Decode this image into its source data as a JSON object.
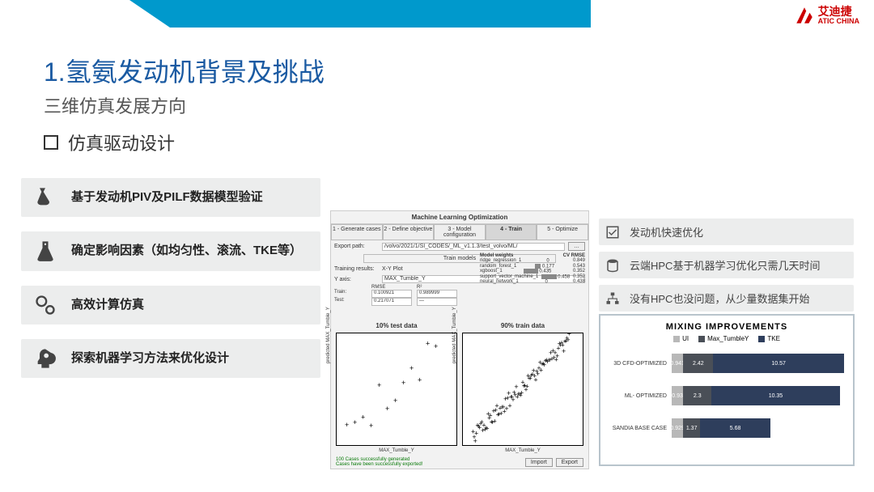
{
  "logo": {
    "cn": "艾迪捷",
    "en": "ATIC CHINA"
  },
  "main_title": "1.氢氨发动机背景及挑战",
  "sub_title": "三维仿真发展方向",
  "bullet": "仿真驱动设计",
  "left_cards": [
    "基于发动机PIV及PILF数据模型验证",
    "确定影响因素（如均匀性、滚流、TKE等）",
    "高效计算仿真",
    "探索机器学习方法来优化设计"
  ],
  "ml_panel": {
    "title": "Machine Learning Optimization",
    "tabs": [
      "1 - Generate cases",
      "2 - Define objective",
      "3 - Model configuration",
      "4 - Train",
      "5 - Optimize"
    ],
    "active_tab_index": 3,
    "export_label": "Export path:",
    "export_path": "/volvo/2021/1/SI_CODES/_ML_v1.1.3/test_volvo/ML/",
    "train_models": "Train models",
    "training_results": "Training results:",
    "plot_mode": "X-Y Plot",
    "yaxis_label": "Y axis:",
    "yaxis_value": "MAX_Tumble_Y",
    "rmse_label": "RMSE",
    "r2_label": "R²",
    "train_label": "Train:",
    "test_label": "Test:",
    "train_rmse": "0.100921",
    "train_r2": "0.989999",
    "test_rmse": "0.217071",
    "test_r2": "—",
    "model_header1": "Model weights",
    "model_header2": "CV RMSE",
    "models": [
      {
        "name": "ridge_regression_1",
        "w": 0,
        "rmse": "0.849"
      },
      {
        "name": "random_forest_1",
        "w": 0.177,
        "rmse": "0.543"
      },
      {
        "name": "xgboost_1",
        "w": 0.435,
        "rmse": "0.352"
      },
      {
        "name": "support_vector_machine_1",
        "w": 0.458,
        "rmse": "0.352"
      },
      {
        "name": "neural_network_1",
        "w": 0,
        "rmse": "0.438"
      }
    ],
    "scatter1_title": "10% test data",
    "scatter2_title": "90% train data",
    "ylabel": "predicted MAX_Tumble_Y",
    "xlabel": "MAX_Tumble_Y",
    "footer1": "100 Cases successfully generated",
    "footer2": "Cases have been successfully exported!",
    "btn_import": "Import",
    "btn_export": "Export"
  },
  "right_cards": [
    "发动机快速优化",
    "云端HPC基于机器学习优化只需几天时间",
    "没有HPC也没问题，从少量数据集开始"
  ],
  "chart_data": {
    "type": "bar",
    "orientation": "horizontal",
    "stacked": true,
    "title": "MIXING IMPROVEMENTS",
    "categories": [
      "3D CFD-OPTIMIZED",
      "ML- OPTIMIZED",
      "SANDIA BASE CASE"
    ],
    "series": [
      {
        "name": "UI",
        "color": "#b8b8b8",
        "values": [
          0.941,
          0.93,
          0.929
        ]
      },
      {
        "name": "Max_TumbleY",
        "color": "#4a4f57",
        "values": [
          2.42,
          2.3,
          1.37
        ]
      },
      {
        "name": "TKE",
        "color": "#2e3e5c",
        "values": [
          10.57,
          10.35,
          5.68
        ]
      }
    ],
    "xlim": [
      0,
      14
    ]
  }
}
